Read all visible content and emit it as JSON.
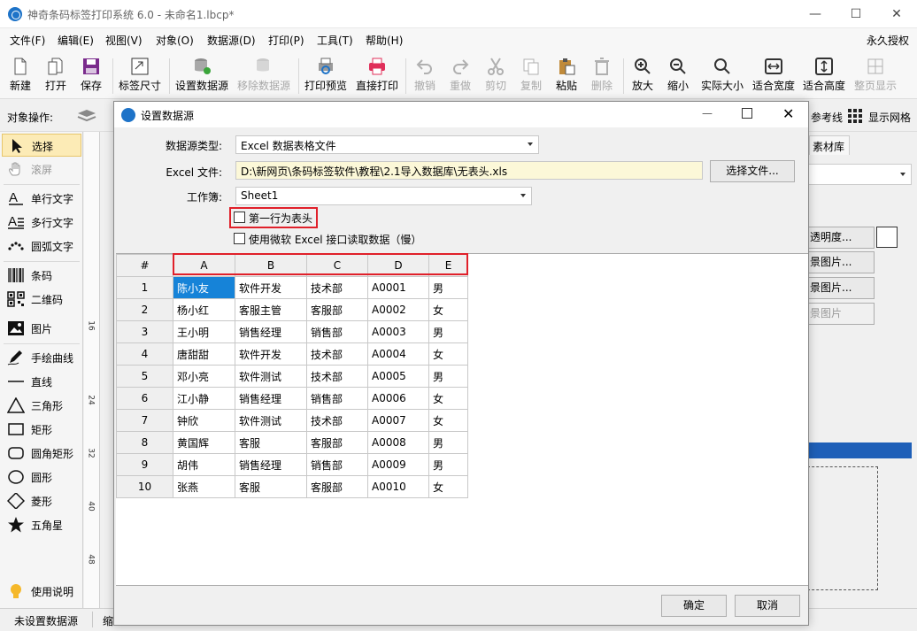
{
  "window": {
    "title": "神奇条码标签打印系统 6.0 - 未命名1.lbcp*",
    "min": "—",
    "max": "☐",
    "close": "✕"
  },
  "menu": [
    "文件(F)",
    "编辑(E)",
    "视图(V)",
    "对象(O)",
    "数据源(D)",
    "打印(P)",
    "工具(T)",
    "帮助(H)"
  ],
  "menu_right": "永久授权",
  "toolbar": {
    "new": "新建",
    "open": "打开",
    "save": "保存",
    "label_size": "标签尺寸",
    "set_datasource": "设置数据源",
    "remove_datasource": "移除数据源",
    "print_preview": "打印预览",
    "direct_print": "直接打印",
    "undo": "撤销",
    "redo": "重做",
    "cut": "剪切",
    "copy": "复制",
    "paste": "粘贴",
    "delete": "删除",
    "zoom_in": "放大",
    "zoom_out": "缩小",
    "actual_size": "实际大小",
    "fit_width": "适合宽度",
    "fit_height": "适合高度",
    "full_page": "整页显示"
  },
  "objbar": {
    "label": "对象操作:",
    "guides": "参考线",
    "show_grid": "显示网格"
  },
  "left_panel": [
    "选择",
    "滚屏",
    "单行文字",
    "多行文字",
    "圆弧文字",
    "条码",
    "二维码",
    "图片",
    "手绘曲线",
    "直线",
    "三角形",
    "矩形",
    "圆角矩形",
    "圆形",
    "菱形",
    "五角星",
    "使用说明"
  ],
  "ruler_marks": [
    "16",
    "24",
    "32",
    "40",
    "48"
  ],
  "right_panel": {
    "tab": "素材库",
    "btn1": "透明度...",
    "btn2": "景图片...",
    "btn3": "景图片...",
    "btn4": "景图片"
  },
  "status": {
    "datasource": "未设置数据源",
    "extra": "缩"
  },
  "dialog": {
    "title": "设置数据源",
    "ds_type_label": "数据源类型:",
    "ds_type_value": "Excel 数据表格文件",
    "excel_file_label": "Excel 文件:",
    "excel_file_value": "D:\\新网页\\条码标签软件\\教程\\2.1导入数据库\\无表头.xls",
    "choose_file": "选择文件...",
    "workbook_label": "工作簿:",
    "workbook_value": "Sheet1",
    "first_row_header": "第一行为表头",
    "use_ms_excel": "使用微软 Excel 接口读取数据（慢）",
    "ok": "确定",
    "cancel": "取消",
    "grid": {
      "corner": "#",
      "columns": [
        "A",
        "B",
        "C",
        "D",
        "E"
      ],
      "rows": [
        [
          "1",
          "陈小友",
          "软件开发",
          "技术部",
          "A0001",
          "男"
        ],
        [
          "2",
          "杨小红",
          "客服主管",
          "客服部",
          "A0002",
          "女"
        ],
        [
          "3",
          "王小明",
          "销售经理",
          "销售部",
          "A0003",
          "男"
        ],
        [
          "4",
          "唐甜甜",
          "软件开发",
          "技术部",
          "A0004",
          "女"
        ],
        [
          "5",
          "邓小亮",
          "软件测试",
          "技术部",
          "A0005",
          "男"
        ],
        [
          "6",
          "江小静",
          "销售经理",
          "销售部",
          "A0006",
          "女"
        ],
        [
          "7",
          "钟欣",
          "软件测试",
          "技术部",
          "A0007",
          "女"
        ],
        [
          "8",
          "黄国辉",
          "客服",
          "客服部",
          "A0008",
          "男"
        ],
        [
          "9",
          "胡伟",
          "销售经理",
          "销售部",
          "A0009",
          "男"
        ],
        [
          "10",
          "张燕",
          "客服",
          "客服部",
          "A0010",
          "女"
        ]
      ]
    }
  },
  "colors": {
    "highlight": "#e0202a",
    "selection": "#1683d8",
    "accent_blue": "#1e73c8"
  }
}
